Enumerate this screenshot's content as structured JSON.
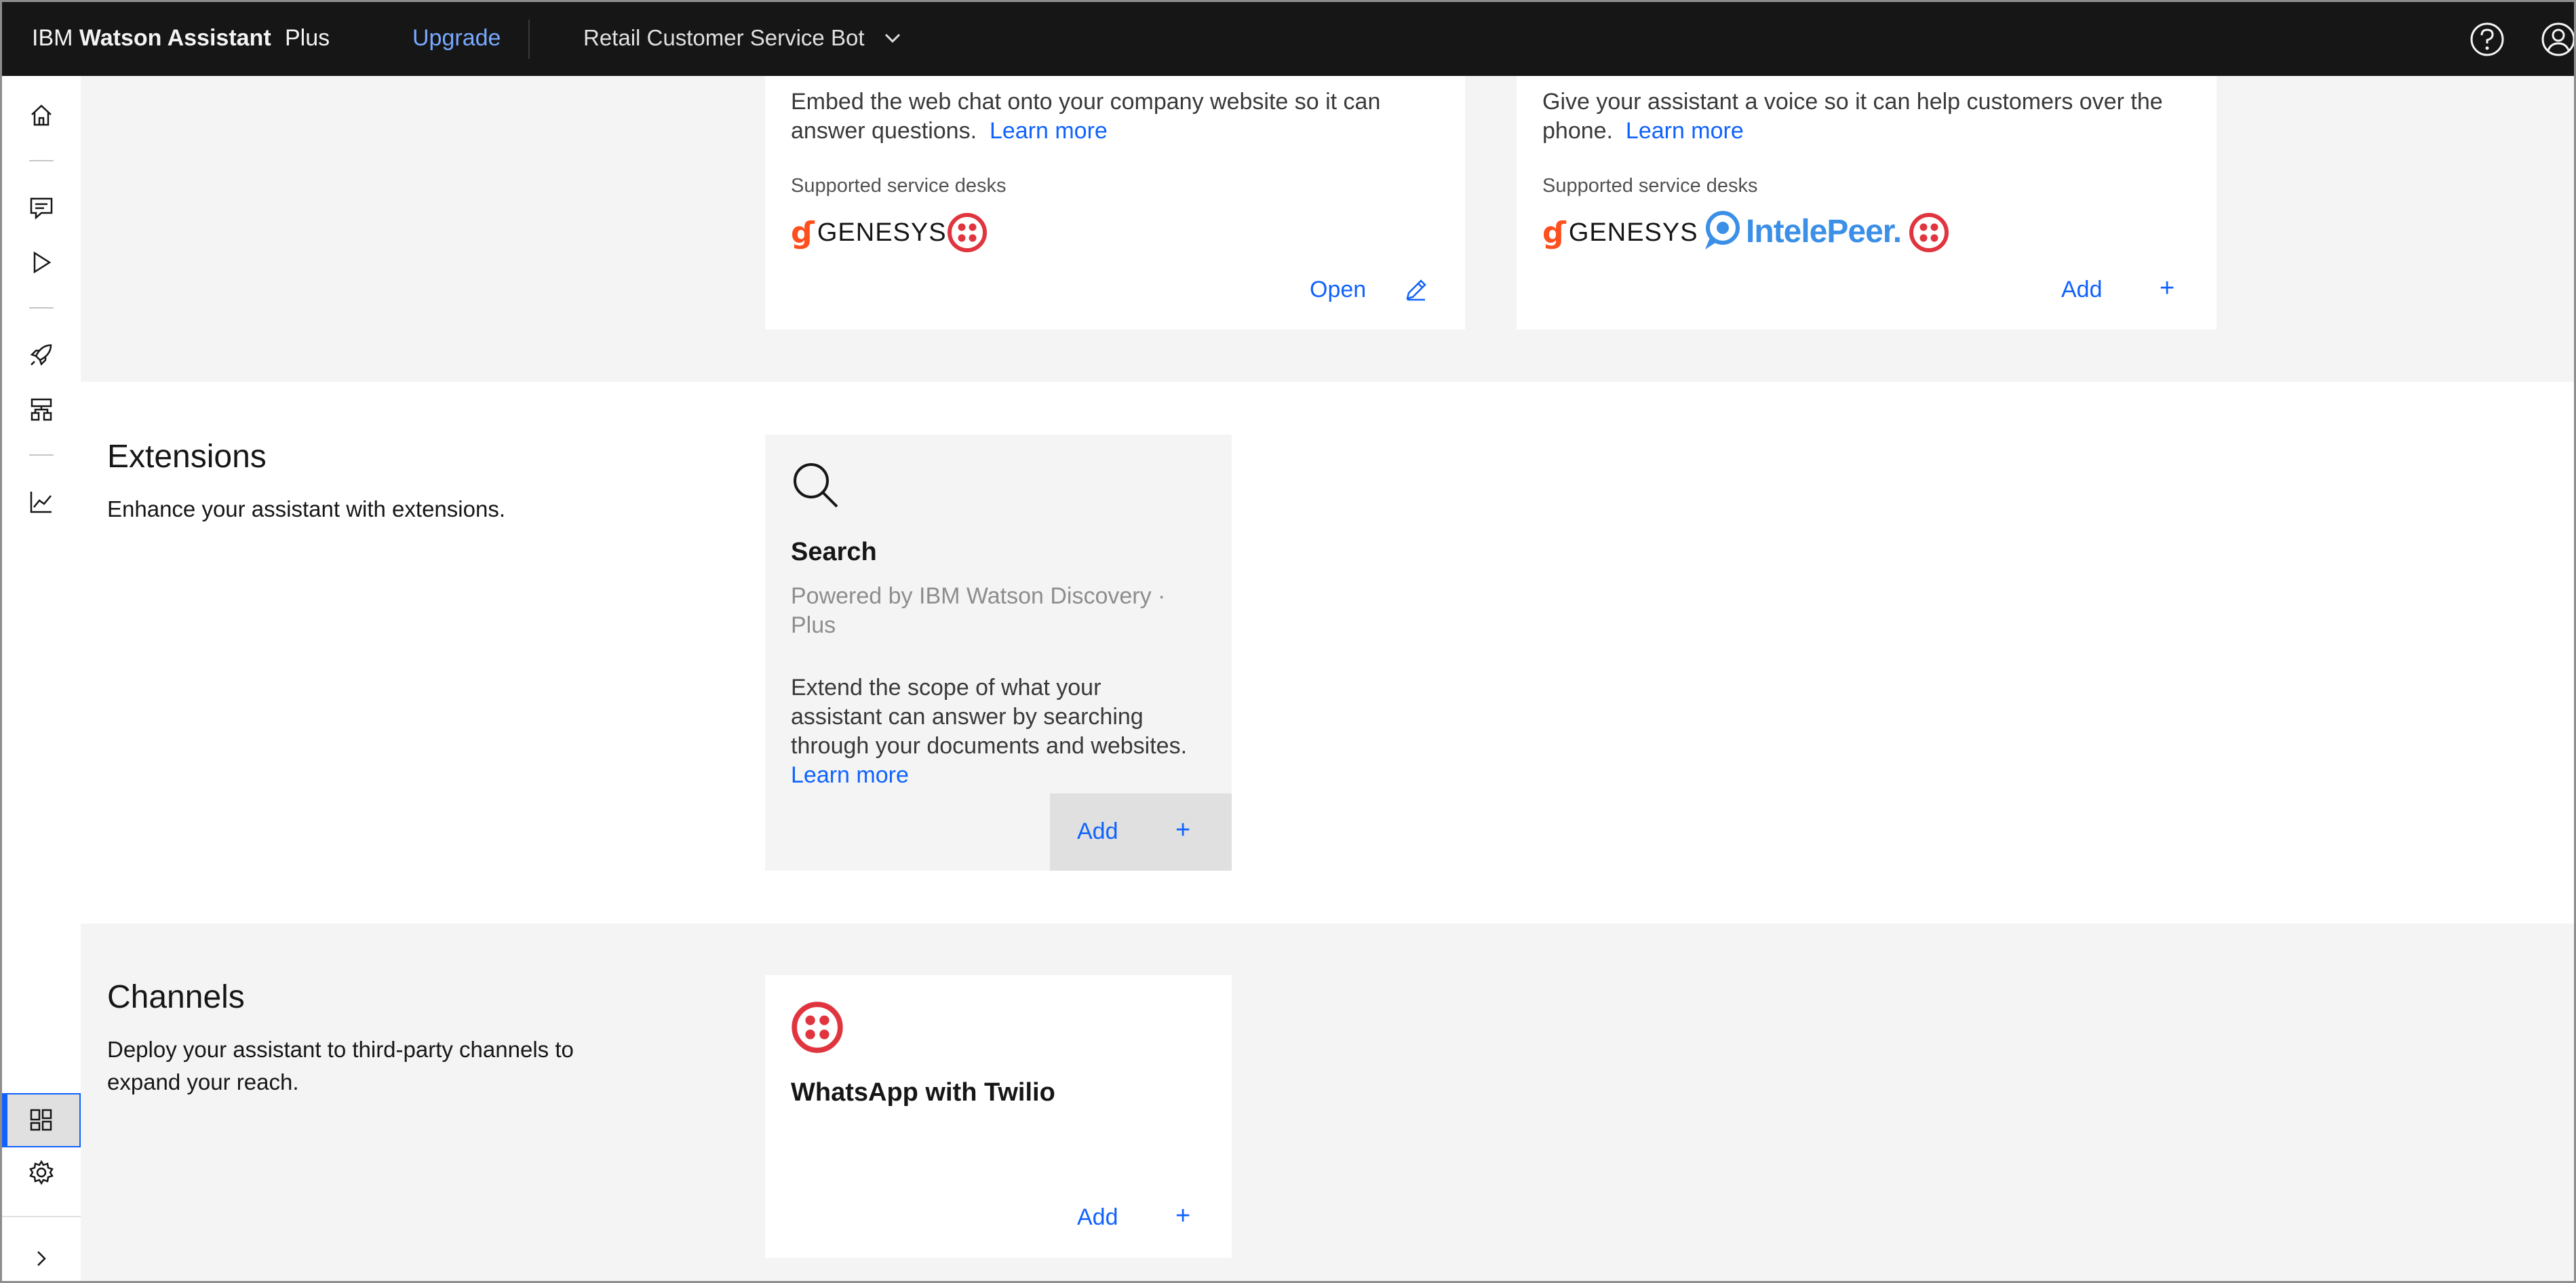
{
  "header": {
    "brand_prefix": "IBM",
    "brand_name": "Watson Assistant",
    "plan": "Plus",
    "upgrade_label": "Upgrade",
    "assistant_name": "Retail Customer Service Bot"
  },
  "integrations": {
    "web_chat_card": {
      "description": "Embed the web chat onto your company website so it can answer questions.",
      "learn_more": "Learn more",
      "service_desks_label": "Supported service desks",
      "service_desks": [
        "GENESYS",
        "Twilio"
      ],
      "action_label": "Open"
    },
    "phone_card": {
      "description": "Give your assistant a voice so it can help customers over the phone.",
      "learn_more": "Learn more",
      "service_desks_label": "Supported service desks",
      "service_desks": [
        "GENESYS",
        "IntelePeer.",
        "Twilio"
      ],
      "action_label": "Add",
      "action_symbol": "+"
    }
  },
  "extensions": {
    "title": "Extensions",
    "description": "Enhance your assistant with extensions.",
    "card": {
      "title": "Search",
      "subtitle": "Powered by IBM Watson Discovery · Plus",
      "description": "Extend the scope of what your assistant can answer by searching through your documents and websites.",
      "learn_more": "Learn more",
      "action_label": "Add",
      "action_symbol": "+"
    }
  },
  "channels": {
    "title": "Channels",
    "description": "Deploy your assistant to third-party channels to expand your reach.",
    "card": {
      "title": "WhatsApp with Twilio",
      "action_label": "Add",
      "action_symbol": "+"
    }
  },
  "colors": {
    "header_bg": "#161616",
    "link": "#0f62fe",
    "upgrade": "#78a9ff",
    "genesys_orange": "#ff4f1f",
    "twilio_red": "#e0353f",
    "intelepeer_blue": "#3b8fe6",
    "section_bg": "#f4f4f4"
  },
  "icons": {
    "sidebar": [
      "home-icon",
      "chat-icon",
      "preview-icon",
      "deploy-rocket-icon",
      "environments-icon",
      "analytics-icon",
      "integrations-icon",
      "settings-icon",
      "expand-chevron-icon"
    ]
  }
}
